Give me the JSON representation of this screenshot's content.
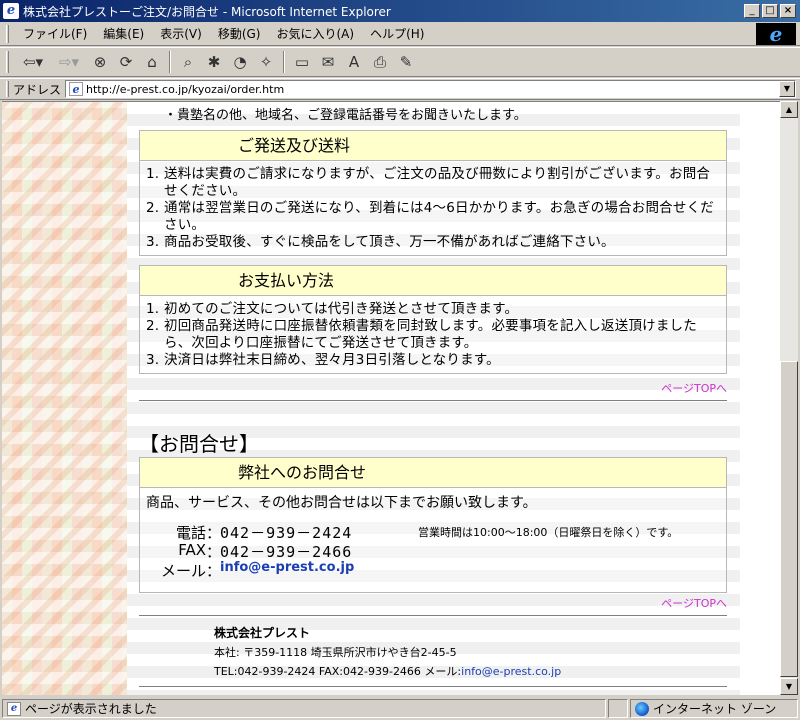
{
  "window": {
    "title": "株式会社プレストーご注文/お問合せ - Microsoft Internet Explorer",
    "buttons": [
      "_",
      "□",
      "×"
    ]
  },
  "menu": [
    "ファイル(F)",
    "編集(E)",
    "表示(V)",
    "移動(G)",
    "お気に入り(A)",
    "ヘルプ(H)"
  ],
  "toolbar": {
    "icons": [
      "back-icon",
      "forward-icon",
      "stop-icon",
      "refresh-icon",
      "home-icon",
      "search-icon",
      "favorites-icon",
      "history-icon",
      "channels-icon",
      "fullscreen-icon",
      "mail-icon",
      "font-icon",
      "print-icon",
      "edit-icon"
    ]
  },
  "address": {
    "label": "アドレス",
    "url": "http://e-prest.co.jp/kyozai/order.htm"
  },
  "page": {
    "top_line": "・貴塾名の他、地域名、ご登録電話番号をお聞きいたします。",
    "shipping": {
      "heading": "ご発送及び送料",
      "items": [
        "送料は実費のご請求になりますが、ご注文の品及び冊数により割引がございます。お問合せください。",
        "通常は翌営業日のご発送になり、到着には4〜6日かかります。お急ぎの場合お問合せください。",
        "商品お受取後、すぐに検品をして頂き、万一不備があればご連絡下さい。"
      ]
    },
    "payment": {
      "heading": "お支払い方法",
      "items": [
        "初めてのご注文については代引き発送とさせて頂きます。",
        "初回商品発送時に口座振替依頼書類を同封致します。必要事項を記入し返送頂けましたら、次回より口座振替にてご発送させて頂きます。",
        "決済日は弊社末日締め、翌々月3日引落しとなります。"
      ]
    },
    "page_top_label": "ページTOPへ",
    "contact_title": "【お問合せ】",
    "contact": {
      "heading": "弊社へのお問合せ",
      "intro": "商品、サービス、その他お問合せは以下までお願い致します。",
      "tel_label": "電話",
      "tel": "042－939－2424",
      "hours": "営業時間は10:00～18:00（日曜祭日を除く）です。",
      "fax_label": "FAX",
      "fax": "042－939－2466",
      "mail_label": "メール",
      "mail": "info@e-prest.co.jp",
      "colon": "："
    },
    "footer": {
      "company": "株式会社プレスト",
      "address": "本社: 〒359-1118 埼玉県所沢市けやき台2-45-5",
      "contact_prefix": "TEL:042-939-2424  FAX:042-939-2466  メール:",
      "mail": "info@e-prest.co.jp"
    }
  },
  "status": {
    "text": "ページが表示されました",
    "zone": "インターネット ゾーン"
  }
}
